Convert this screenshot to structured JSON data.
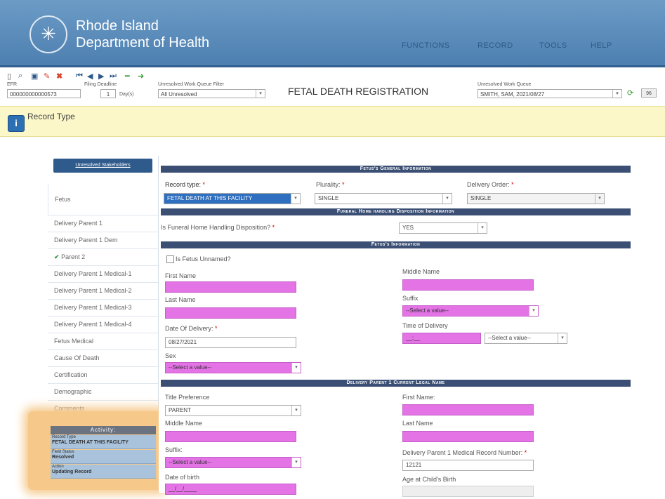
{
  "org": {
    "line1": "Rhode Island",
    "line2": "Department of Health"
  },
  "nav": [
    "FUNCTIONS",
    "RECORD",
    "TOOLS",
    "HELP"
  ],
  "toolbar": {
    "efr_label": "EFR",
    "efr_value": "000000000000573",
    "filing_label": "Filing Deadline",
    "filing_days": "1",
    "filing_unit": "Day(s)",
    "filter_label": "Unresolved Work Queue Filter",
    "filter_value": "All Unresolved",
    "queue_label": "Unresolved Work Queue",
    "queue_value": "SMITH, SAM, 2021/08/27",
    "go_label": "96"
  },
  "page_title": "FETAL DEATH REGISTRATION",
  "notice": "Record Type",
  "sidebar": {
    "section_button": "Unresolved Stakeholders",
    "active": "Fetus",
    "items": [
      "Delivery Parent 1",
      "Delivery Parent 1 Dem",
      "Parent 2",
      "Delivery Parent 1 Medical-1",
      "Delivery Parent 1 Medical-2",
      "Delivery Parent 1 Medical-3",
      "Delivery Parent 1 Medical-4",
      "Fetus Medical",
      "Cause Of Death",
      "Certification",
      "Demographic",
      "Comments"
    ],
    "check_glyph": "✔"
  },
  "activity": {
    "title": "Activity:",
    "rows": [
      {
        "label": "Record Type",
        "value": "FETAL DEATH AT THIS FACILITY"
      },
      {
        "label": "Field Status",
        "value": "Resolved"
      },
      {
        "label": "Action",
        "value": "Updating Record"
      }
    ]
  },
  "sections": {
    "general": "Fetus's General Information",
    "funeral": "Funeral Home handling Disposition Information",
    "fetus_info": "Fetus's Information",
    "legal_name": "Delivery Parent 1 Current Legal Name"
  },
  "general": {
    "record_type_label": "Record type:",
    "record_type_value": "FETAL DEATH AT THIS FACILITY",
    "plurality_label": "Plurality:",
    "plurality_value": "SINGLE",
    "order_label": "Delivery Order:",
    "order_value": "SINGLE"
  },
  "funeral": {
    "question": "Is Funeral Home Handling Disposition?",
    "value": "YES"
  },
  "fetus": {
    "unnamed_label": "Is Fetus Unnamed?",
    "first_name": "First Name",
    "middle_name": "Middle Name",
    "last_name": "Last Name",
    "suffix_label": "Suffix",
    "suffix_placeholder": "--Select a value--",
    "dod_label": "Date Of Delivery:",
    "dod_value": "08/27/2021",
    "tod_label": "Time of Delivery",
    "tod_value": "__:__",
    "tod_select": "--Select a value--",
    "sex_label": "Sex",
    "sex_placeholder": "--Select a value--"
  },
  "legal": {
    "title_label": "Title Preference",
    "title_value": "PARENT",
    "first_name": "First Name:",
    "middle_name": "Middle Name",
    "last_name": "Last Name",
    "suffix_label": "Suffix:",
    "suffix_placeholder": "--Select a value--",
    "mrn_label": "Delivery Parent 1 Medical Record Number:",
    "mrn_value": "12121",
    "dob_label": "Date of birth",
    "dob_value": "__/__/____",
    "age_label": "Age at Child's Birth"
  },
  "icons": [
    "new-icon",
    "find-icon",
    "save-icon",
    "edit-icon",
    "delete-icon",
    "first-icon",
    "prev-icon",
    "next-icon",
    "last-icon",
    "minus-icon",
    "arrow-icon",
    "refresh-icon",
    "info-icon"
  ],
  "colors": {
    "header": "#5b8dbc",
    "band": "#3b4f74",
    "required": "#e473e6",
    "notice": "#fbf7c9",
    "highlight": "#f6c98b"
  }
}
